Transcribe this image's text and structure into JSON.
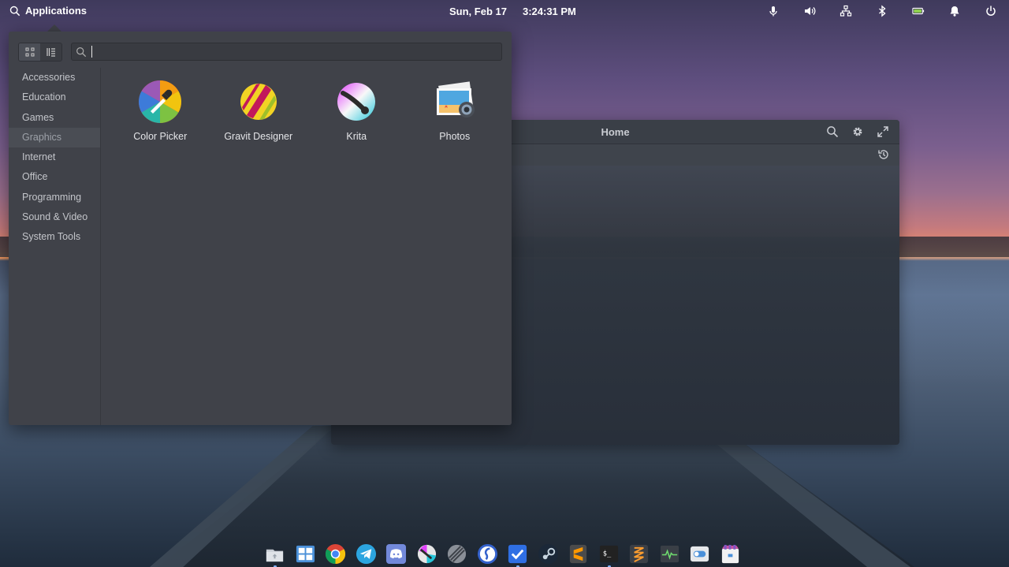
{
  "top_panel": {
    "applications_label": "Applications",
    "date": "Sun, Feb 17",
    "time": "3:24:31 PM",
    "indicators": [
      "microphone-icon",
      "volume-icon",
      "network-icon",
      "bluetooth-icon",
      "battery-icon",
      "notifications-icon",
      "power-icon"
    ]
  },
  "files_window": {
    "title": "Home",
    "tools": [
      "search-icon",
      "gear-icon",
      "maximize-icon"
    ],
    "history_icon": "history-icon"
  },
  "apps_menu": {
    "search": {
      "placeholder": "",
      "value": ""
    },
    "categories": [
      {
        "label": "Accessories",
        "active": false
      },
      {
        "label": "Education",
        "active": false
      },
      {
        "label": "Games",
        "active": false
      },
      {
        "label": "Graphics",
        "active": true
      },
      {
        "label": "Internet",
        "active": false
      },
      {
        "label": "Office",
        "active": false
      },
      {
        "label": "Programming",
        "active": false
      },
      {
        "label": "Sound & Video",
        "active": false
      },
      {
        "label": "System Tools",
        "active": false
      }
    ],
    "apps": [
      {
        "label": "Color Picker",
        "icon": "color-picker-icon"
      },
      {
        "label": "Gravit Designer",
        "icon": "gravit-designer-icon"
      },
      {
        "label": "Krita",
        "icon": "krita-icon"
      },
      {
        "label": "Photos",
        "icon": "photos-icon"
      }
    ]
  },
  "dock": {
    "items": [
      "files-icon",
      "multitasking-icon",
      "chrome-icon",
      "telegram-icon",
      "discord-icon",
      "krita-icon",
      "gravit-icon",
      "simplenote-icon",
      "tasks-icon",
      "steam-icon",
      "sublime-text-icon",
      "terminal-icon",
      "code-icon",
      "system-monitor-icon",
      "settings-toggle-icon",
      "appcenter-icon"
    ]
  },
  "colors": {
    "menu_bg": "#404249",
    "accent": "#7fb2ff",
    "panel_text": "#ffffff"
  }
}
